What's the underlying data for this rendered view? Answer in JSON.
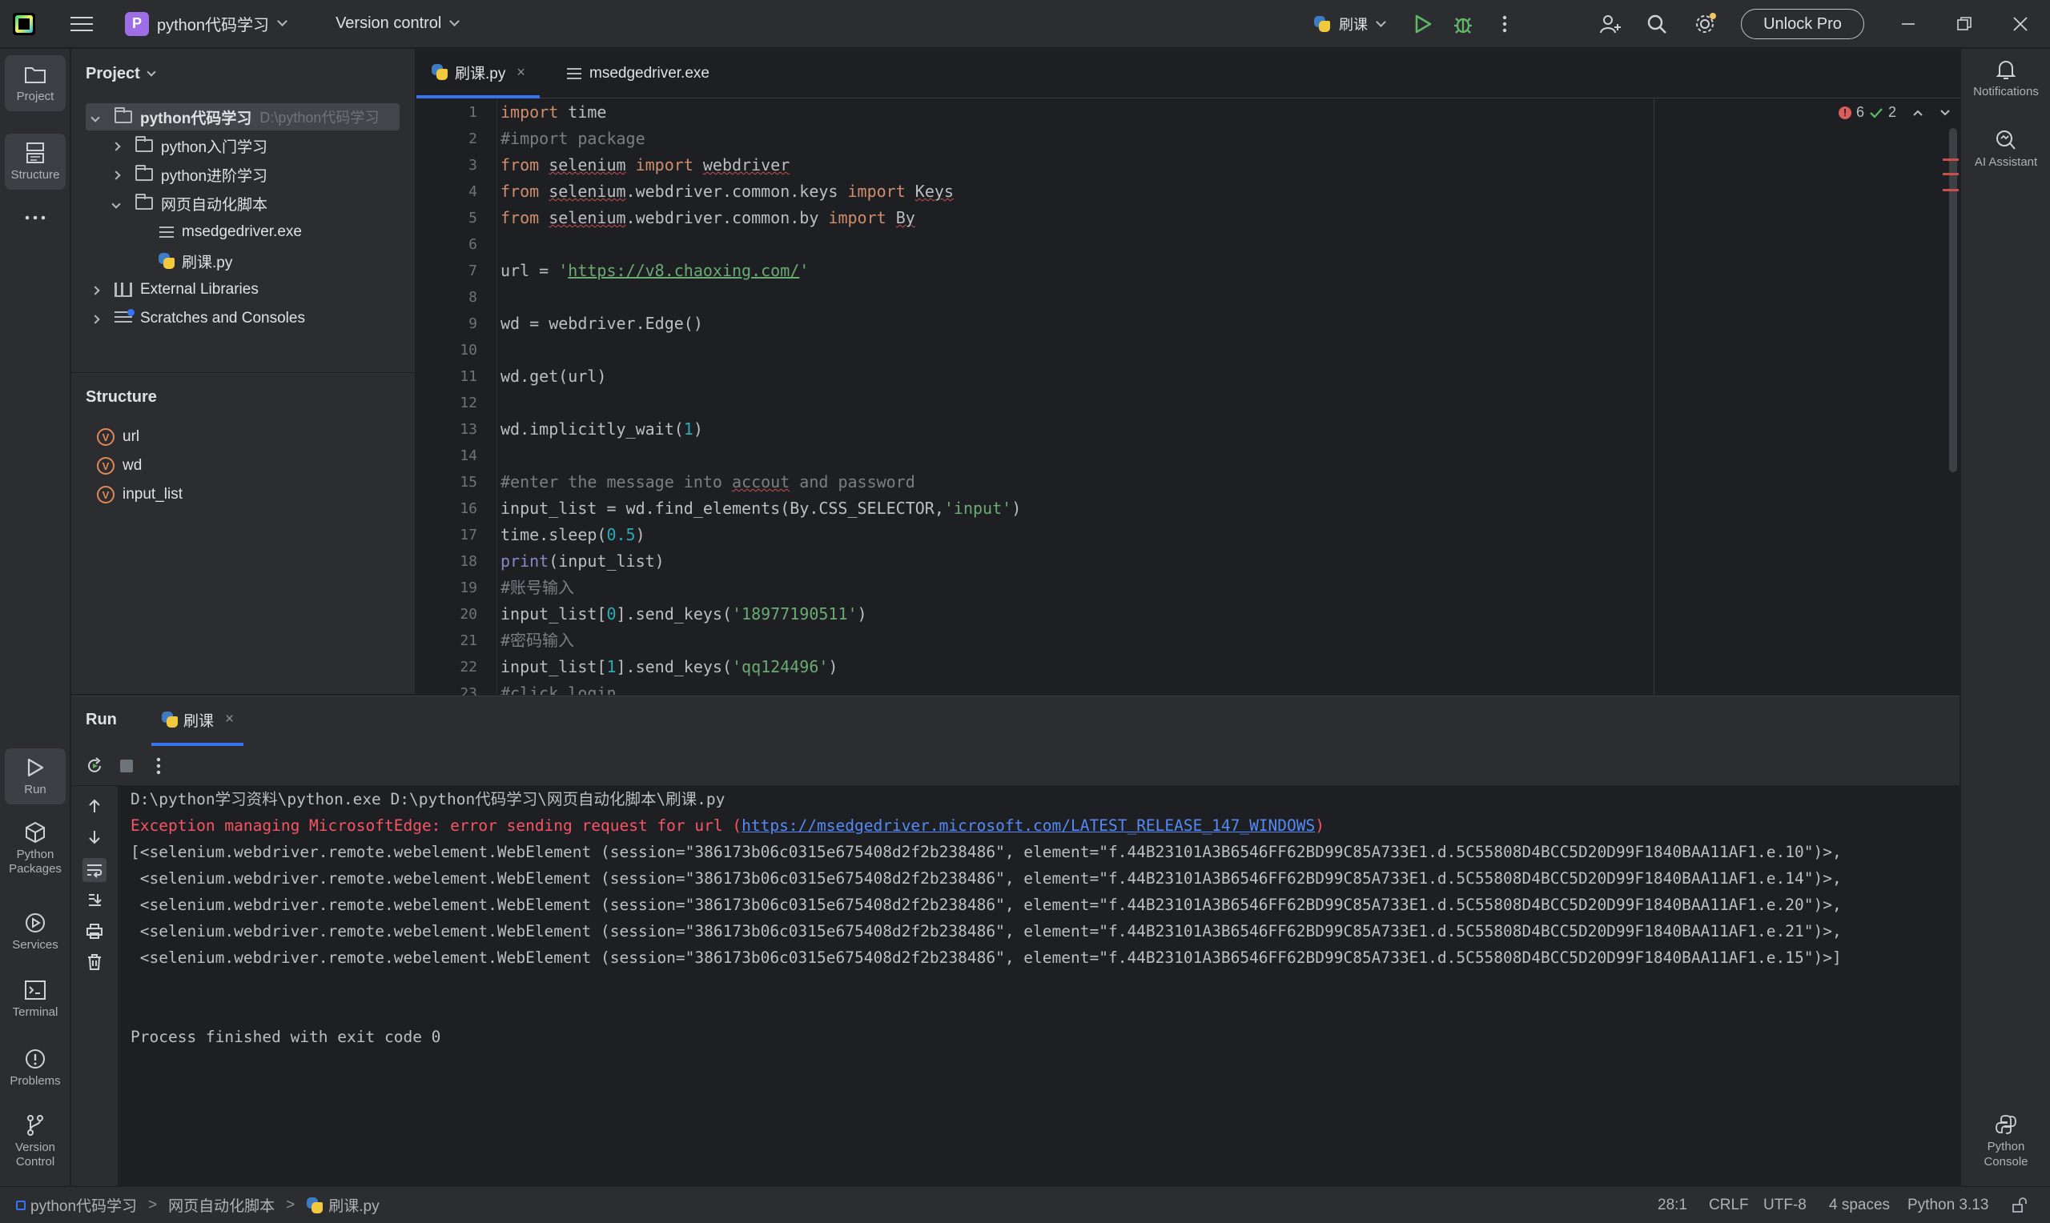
{
  "titlebar": {
    "project_badge": "P",
    "project_name": "python代码学习",
    "vcs": "Version control",
    "run_config": "刷课",
    "unlock": "Unlock Pro"
  },
  "left_tools": [
    {
      "label": "Project"
    },
    {
      "label": "Structure"
    },
    {
      "label": "Run"
    },
    {
      "label": "Python Packages"
    },
    {
      "label": "Services"
    },
    {
      "label": "Terminal"
    },
    {
      "label": "Problems"
    },
    {
      "label": "Version Control"
    }
  ],
  "right_tools": [
    {
      "label": "Notifications"
    },
    {
      "label": "AI Assistant"
    },
    {
      "label": "Python Console"
    }
  ],
  "project_panel": {
    "title": "Project",
    "root_name": "python代码学习",
    "root_path": "D:\\python代码学习",
    "items": [
      {
        "label": "python入门学习"
      },
      {
        "label": "python进阶学习"
      },
      {
        "label": "网页自动化脚本"
      },
      {
        "label": "msedgedriver.exe"
      },
      {
        "label": "刷课.py"
      },
      {
        "label": "External Libraries"
      },
      {
        "label": "Scratches and Consoles"
      }
    ]
  },
  "structure_panel": {
    "title": "Structure",
    "items": [
      "url",
      "wd",
      "input_list"
    ],
    "badge": "V"
  },
  "editor": {
    "tabs": [
      {
        "label": "刷课.py",
        "close": "×"
      },
      {
        "label": "msedgedriver.exe"
      }
    ],
    "errors": "6",
    "warnings": "2",
    "line_numbers": [
      "1",
      "2",
      "3",
      "4",
      "5",
      "6",
      "7",
      "8",
      "9",
      "10",
      "11",
      "12",
      "13",
      "14",
      "15",
      "16",
      "17",
      "18",
      "19",
      "20",
      "21",
      "22",
      "23"
    ]
  },
  "run_panel": {
    "title": "Run",
    "tab": "刷课",
    "tab_close": "×",
    "console": {
      "cmd": "D:\\python学习资料\\python.exe D:\\python代码学习\\网页自动化脚本\\刷课.py",
      "err_prefix": "Exception managing MicrosoftEdge: error sending request for url (",
      "err_link": "https://msedgedriver.microsoft.com/LATEST_RELEASE_147_WINDOWS",
      "err_suffix": ")",
      "elements": [
        "[<selenium.webdriver.remote.webelement.WebElement (session=\"386173b06c0315e675408d2f2b238486\", element=\"f.44B23101A3B6546FF62BD99C85A733E1.d.5C55808D4BCC5D20D99F1840BAA11AF1.e.10\")>,",
        " <selenium.webdriver.remote.webelement.WebElement (session=\"386173b06c0315e675408d2f2b238486\", element=\"f.44B23101A3B6546FF62BD99C85A733E1.d.5C55808D4BCC5D20D99F1840BAA11AF1.e.14\")>,",
        " <selenium.webdriver.remote.webelement.WebElement (session=\"386173b06c0315e675408d2f2b238486\", element=\"f.44B23101A3B6546FF62BD99C85A733E1.d.5C55808D4BCC5D20D99F1840BAA11AF1.e.20\")>,",
        " <selenium.webdriver.remote.webelement.WebElement (session=\"386173b06c0315e675408d2f2b238486\", element=\"f.44B23101A3B6546FF62BD99C85A733E1.d.5C55808D4BCC5D20D99F1840BAA11AF1.e.21\")>,",
        " <selenium.webdriver.remote.webelement.WebElement (session=\"386173b06c0315e675408d2f2b238486\", element=\"f.44B23101A3B6546FF62BD99C85A733E1.d.5C55808D4BCC5D20D99F1840BAA11AF1.e.15\")>]"
      ],
      "finished": "Process finished with exit code 0"
    }
  },
  "statusbar": {
    "crumbs": [
      "python代码学习",
      "网页自动化脚本",
      "刷课.py"
    ],
    "separator": ">",
    "position": "28:1",
    "line_sep": "CRLF",
    "encoding": "UTF-8",
    "indent": "4 spaces",
    "interpreter": "Python 3.13"
  },
  "colors": {
    "accent": "#3574f0",
    "error": "#f75464",
    "keyword": "#cf8e6d",
    "string": "#6aab73"
  }
}
